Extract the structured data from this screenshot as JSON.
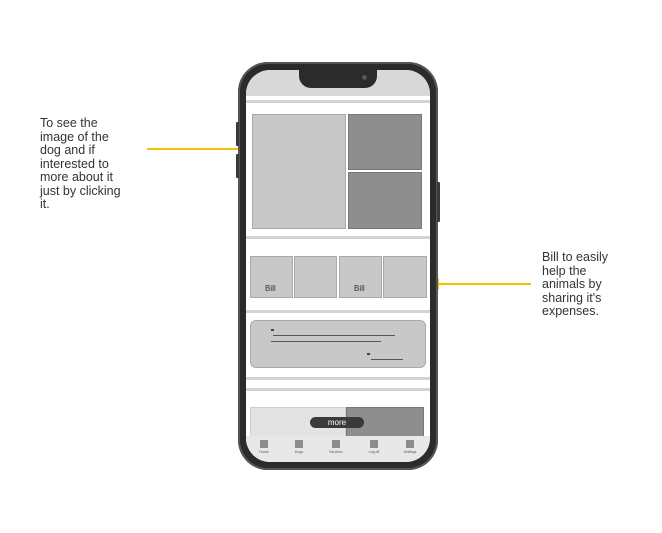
{
  "annotations": {
    "left": "To see the\nimage of the\ndog and if\ninterested to\nmore about  it\njust by clicking\nit.",
    "right": "Bill to easily\nhelp the\nanimals by\nsharing it's\nexpenses."
  },
  "colors": {
    "arrow": "#f2c200",
    "phone_frame": "#2b2b2b"
  },
  "bill_cards": [
    {
      "label": "Bill"
    },
    {
      "label": ""
    },
    {
      "label": "Bill"
    },
    {
      "label": ""
    }
  ],
  "more_button": {
    "label": "more"
  },
  "tabbar": [
    {
      "icon": "home-icon",
      "label": "Home"
    },
    {
      "icon": "dogs-icon",
      "label": "Dogs"
    },
    {
      "icon": "services-icon",
      "label": "Services"
    },
    {
      "icon": "log-off-icon",
      "label": "Log off"
    },
    {
      "icon": "more-icon",
      "label": "Settings"
    }
  ]
}
